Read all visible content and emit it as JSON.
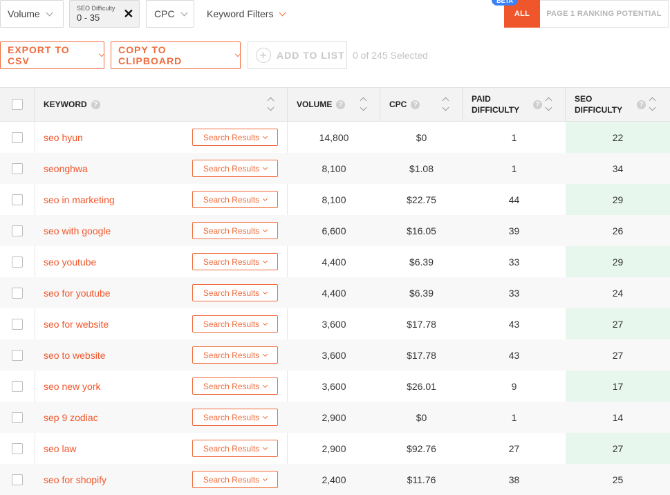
{
  "filters": {
    "volume_label": "Volume",
    "seo_difficulty_label": "SEO Difficulty",
    "seo_difficulty_range": "0 - 35",
    "cpc_label": "CPC",
    "keyword_filters_label": "Keyword Filters"
  },
  "view_toggle": {
    "beta_badge": "BETA",
    "all_label": "ALL",
    "page1_label": "PAGE 1 RANKING POTENTIAL"
  },
  "actions": {
    "export_label": "EXPORT TO CSV",
    "copy_label": "COPY TO CLIPBOARD",
    "add_label": "ADD TO LIST",
    "selected_text": "0 of 245 Selected"
  },
  "table": {
    "headers": {
      "keyword": "KEYWORD",
      "volume": "VOLUME",
      "cpc": "CPC",
      "paid_difficulty_line1": "PAID",
      "paid_difficulty_line2": "DIFFICULTY",
      "seo_difficulty_line1": "SEO",
      "seo_difficulty_line2": "DIFFICULTY"
    },
    "search_results_label": "Search Results",
    "rows": [
      {
        "keyword": "seo hyun",
        "volume": "14,800",
        "cpc": "$0",
        "paid": "1",
        "seo": "22"
      },
      {
        "keyword": "seonghwa",
        "volume": "8,100",
        "cpc": "$1.08",
        "paid": "1",
        "seo": "34"
      },
      {
        "keyword": "seo in marketing",
        "volume": "8,100",
        "cpc": "$22.75",
        "paid": "44",
        "seo": "29"
      },
      {
        "keyword": "seo with google",
        "volume": "6,600",
        "cpc": "$16.05",
        "paid": "39",
        "seo": "26"
      },
      {
        "keyword": "seo youtube",
        "volume": "4,400",
        "cpc": "$6.39",
        "paid": "33",
        "seo": "29"
      },
      {
        "keyword": "seo for youtube",
        "volume": "4,400",
        "cpc": "$6.39",
        "paid": "33",
        "seo": "24"
      },
      {
        "keyword": "seo for website",
        "volume": "3,600",
        "cpc": "$17.78",
        "paid": "43",
        "seo": "27"
      },
      {
        "keyword": "seo to website",
        "volume": "3,600",
        "cpc": "$17.78",
        "paid": "43",
        "seo": "27"
      },
      {
        "keyword": "seo new york",
        "volume": "3,600",
        "cpc": "$26.01",
        "paid": "9",
        "seo": "17"
      },
      {
        "keyword": "sep 9 zodiac",
        "volume": "2,900",
        "cpc": "$0",
        "paid": "1",
        "seo": "14"
      },
      {
        "keyword": "seo law",
        "volume": "2,900",
        "cpc": "$92.76",
        "paid": "27",
        "seo": "27"
      },
      {
        "keyword": "seo for shopify",
        "volume": "2,400",
        "cpc": "$11.76",
        "paid": "38",
        "seo": "25"
      }
    ]
  },
  "colors": {
    "accent": "#f0562b",
    "seo_column_bg": "#e7f7ee",
    "beta_badge": "#3b82f6"
  }
}
